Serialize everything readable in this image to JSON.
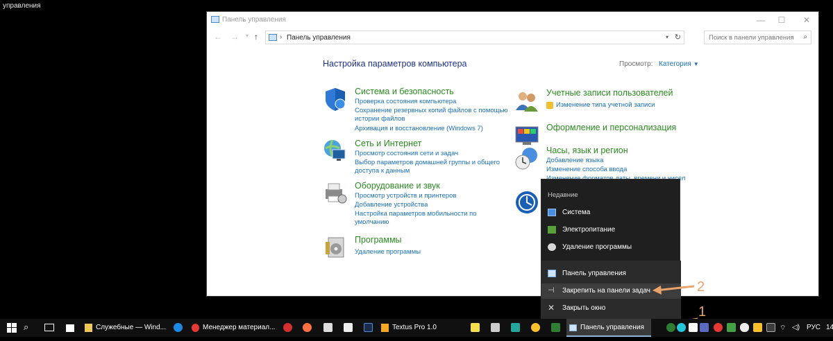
{
  "desktop": {
    "label": "управления"
  },
  "window": {
    "title": "Панель управления",
    "min_glyph": "—",
    "max_glyph": "☐",
    "close_glyph": "✕",
    "address": "Панель управления",
    "search_placeholder": "Поиск в панели управления",
    "heading": "Настройка параметров компьютера",
    "view_label": "Просмотр:",
    "view_value": "Категория"
  },
  "categories": [
    {
      "title": "Система и безопасность",
      "links": [
        "Проверка состояния компьютера",
        "Сохранение резервных копий файлов с помощью",
        "истории файлов",
        "Архивация и восстановление (Windows 7)"
      ]
    },
    {
      "title": "Сеть и Интернет",
      "links": [
        "Просмотр состояния сети и задач",
        "Выбор параметров домашней группы и общего",
        "доступа к данным"
      ]
    },
    {
      "title": "Оборудование и звук",
      "links": [
        "Просмотр устройств и принтеров",
        "Добавление устройства",
        "Настройка параметров мобильности по",
        "умолчанию"
      ]
    },
    {
      "title": "Программы",
      "links": [
        "Удаление программы"
      ]
    },
    {
      "title": "Учетные записи пользователей",
      "links": [
        "Изменение типа учетной записи"
      ]
    },
    {
      "title": "Оформление и персонализация",
      "links": []
    },
    {
      "title": "Часы, язык и регион",
      "links": [
        "Добавление языка",
        "Изменение способа ввода",
        "Изменение форматов даты, времени и чисел"
      ]
    }
  ],
  "jumplist": {
    "header": "Недавние",
    "recent": [
      "Система",
      "Электропитание",
      "Удаление программы"
    ],
    "actions": [
      "Панель управления",
      "Закрепить на панели задач",
      "Закрыть окно"
    ]
  },
  "annotations": {
    "one": "1",
    "two": "2"
  },
  "taskbar": {
    "apps": [
      "Служебные — Wind...",
      "Менеджер материал...",
      "Textus Pro 1.0",
      "Панель управления"
    ],
    "language": "РУС",
    "clock": "14"
  },
  "colors": {
    "accent_green": "#2b8a1f",
    "link_blue": "#1a6fb9",
    "heading_blue": "#1e3287",
    "annotation": "#e8a46b"
  }
}
